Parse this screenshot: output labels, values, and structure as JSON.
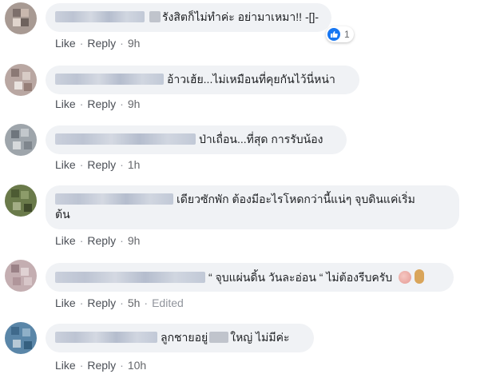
{
  "actions": {
    "like": "Like",
    "reply": "Reply",
    "edited": "Edited",
    "dot": "·"
  },
  "comments": [
    {
      "text_before": "",
      "text": "รังสิตก็ไม่ทำค่ะ อย่ามาเหมา!! -[]-",
      "time": "9h",
      "reaction_count": "1",
      "reaction_icon": "like-icon"
    },
    {
      "text": "อ้าวเฮ้ย...ไม่เหมือนที่คุยกันไว้นี่หน่า",
      "time": "9h"
    },
    {
      "text": "ป่าเถื่อน...ที่สุด การรับน้อง",
      "time": "1h"
    },
    {
      "text_line1": "เดียวซักพัก ต้องมีอะไรโหดกว่านี้แน่ๆ จุบดินแค่เริ่ม",
      "text_line2": "ต้น",
      "time": "9h"
    },
    {
      "text": "“ จุบแผ่นดิ้น วันละอ่อน “ ไม่ต้องรีบครับ",
      "time": "5h",
      "edited": true,
      "emoji_icons": [
        "brain-icon",
        "peanut-icon"
      ]
    },
    {
      "text_a": "ลูกชายอยู่",
      "text_b": "ใหญ่ ไม่มีค่ะ",
      "time": "10h"
    }
  ]
}
